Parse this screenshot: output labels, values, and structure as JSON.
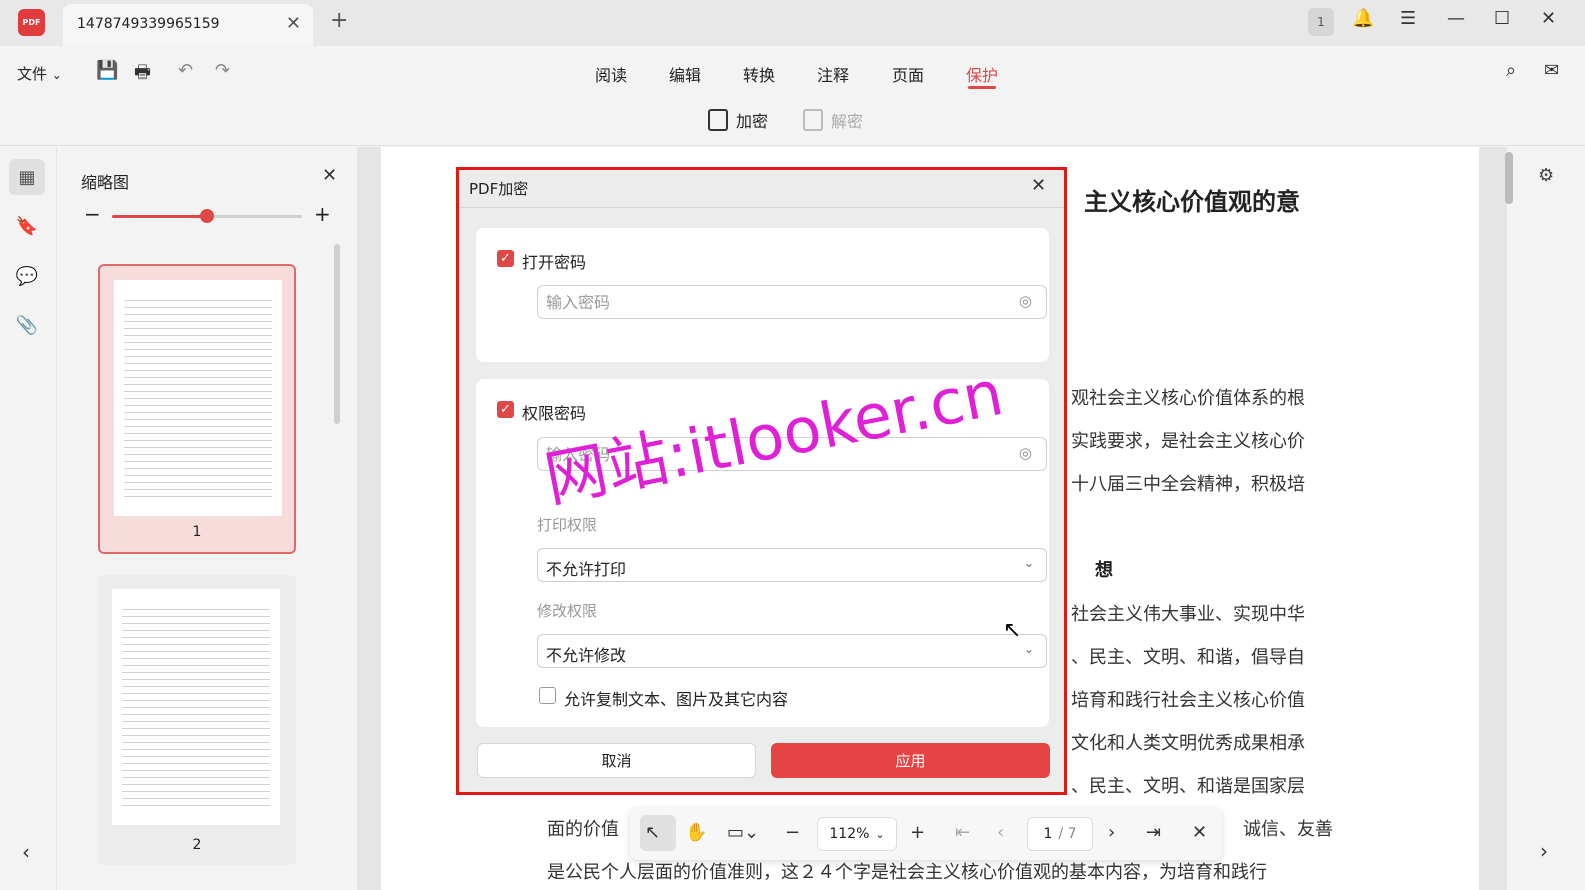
{
  "app": {
    "logo_text": "PDF",
    "tab_title": "1478749339965159",
    "notification_count": "1"
  },
  "menu": {
    "file_label": "文件",
    "file_arrow": "⌄"
  },
  "nav": {
    "items": [
      "阅读",
      "编辑",
      "转换",
      "注释",
      "页面",
      "保护"
    ],
    "active_index": 5
  },
  "protect": {
    "encrypt_label": "加密",
    "decrypt_label": "解密"
  },
  "thumbnails": {
    "title": "缩略图",
    "zoom_level": 0.5,
    "pages": [
      "1",
      "2"
    ],
    "selected_page": "1"
  },
  "document": {
    "heading": "主义核心价值观的意",
    "lines": [
      "观社会主义核心价值体系的根",
      "实践要求，是社会主义核心价",
      "十八届三中全会精神，积极培",
      "社会主义伟大事业、实现中华",
      "、民主、文明、和谐，倡导自",
      "培育和践行社会主义核心价值",
      "文化和人类文明优秀成果相承",
      "、民主、文明、和谐是国家层",
      "诚信、友善",
      "面的价值",
      "是公民个人层面的价值准则，这２４个字是社会主义核心价值观的基本内容，为培育和践行"
    ],
    "subheading": "想"
  },
  "dialog": {
    "title": "PDF加密",
    "open_password": {
      "label": "打开密码",
      "checked": true,
      "placeholder": "输入密码",
      "value": ""
    },
    "permission_password": {
      "label": "权限密码",
      "checked": true,
      "placeholder": "输入密码",
      "value": ""
    },
    "print_permission": {
      "label": "打印权限",
      "value": "不允许打印"
    },
    "modify_permission": {
      "label": "修改权限",
      "value": "不允许修改"
    },
    "allow_copy": {
      "label": "允许复制文本、图片及其它内容",
      "checked": false
    },
    "cancel_label": "取消",
    "apply_label": "应用"
  },
  "bottom_toolbar": {
    "zoom": "112%",
    "current_page": "1",
    "total_pages": "/ 7"
  },
  "watermark": "网站:itlooker.cn",
  "colors": {
    "accent": "#e04848",
    "highlight_outline": "#e01818",
    "watermark": "#e020d6"
  }
}
